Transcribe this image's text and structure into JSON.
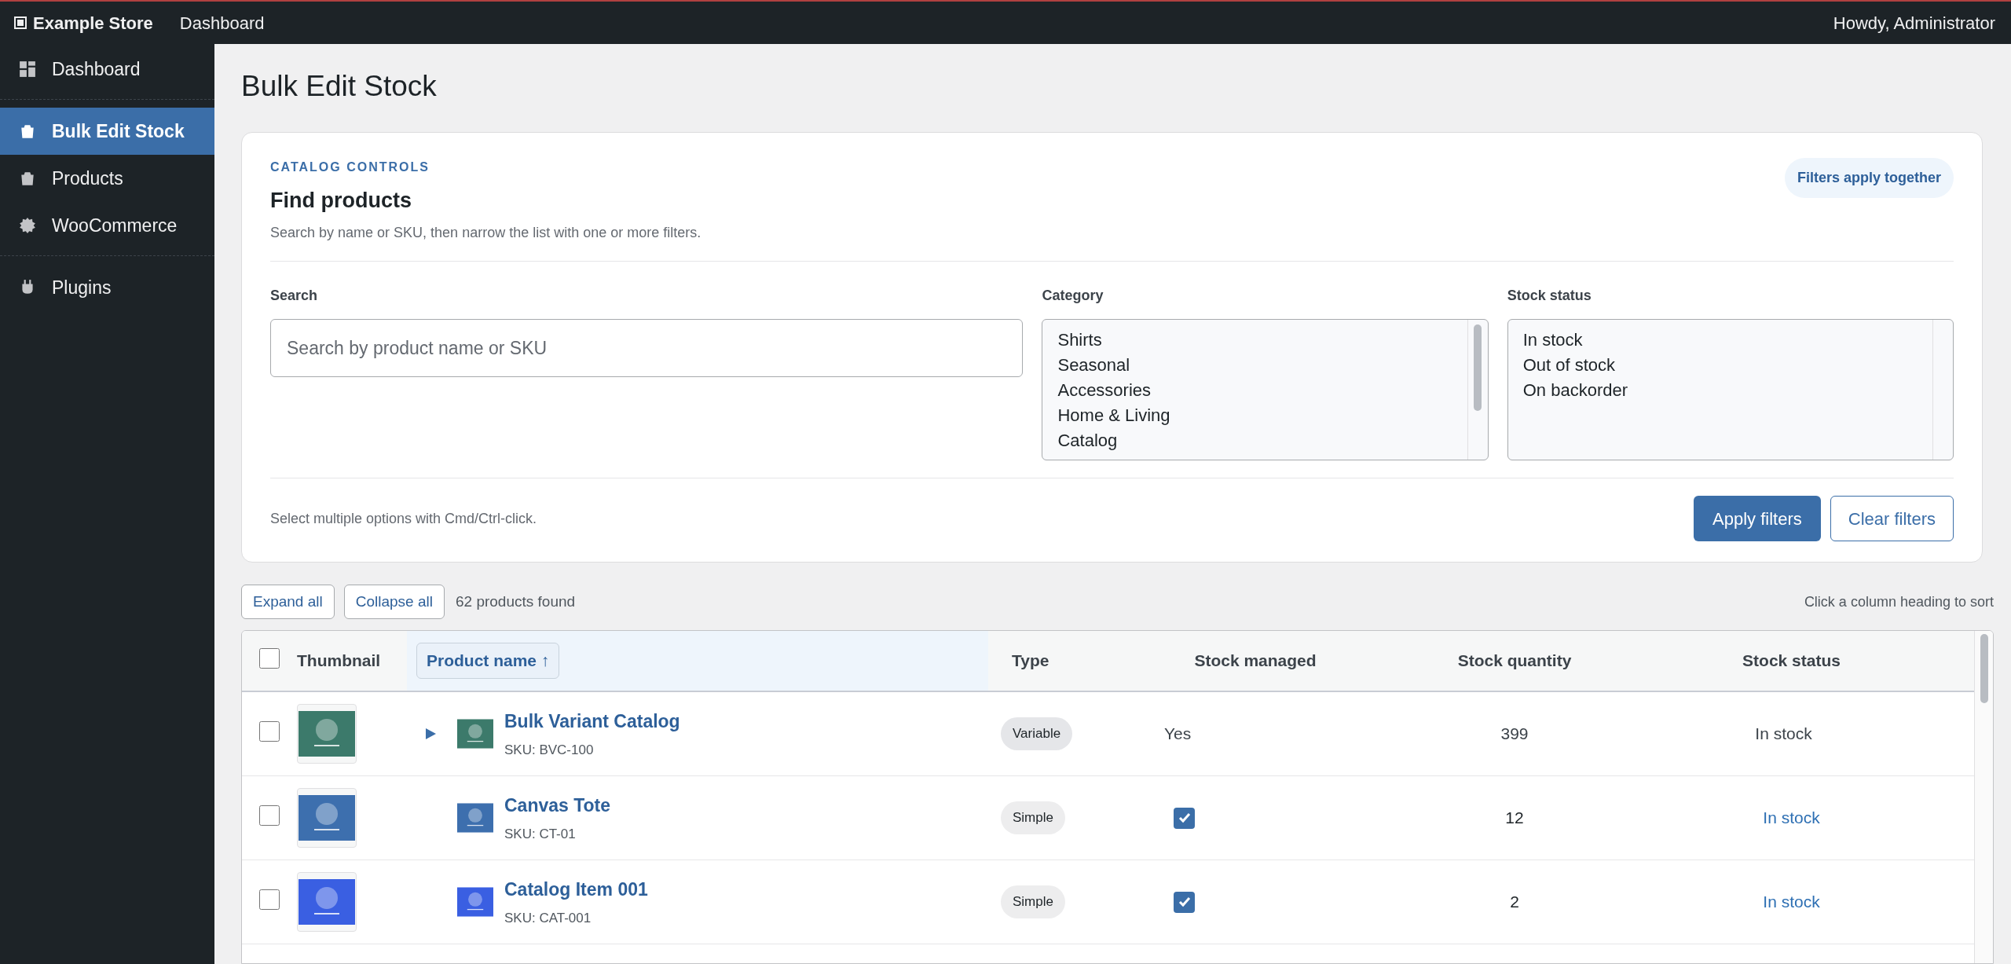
{
  "top_bar": {
    "site": "Example Store",
    "link": "Dashboard",
    "greeting": "Howdy, Administrator"
  },
  "sidebar": {
    "groups": [
      [
        {
          "label": "Dashboard",
          "kind": "dashboard",
          "selected": false
        }
      ],
      [
        {
          "label": "Bulk Edit Stock",
          "kind": "bag",
          "selected": true
        },
        {
          "label": "Products",
          "kind": "bag",
          "selected": false
        },
        {
          "label": "WooCommerce",
          "kind": "gear",
          "selected": false
        }
      ],
      [
        {
          "label": "Plugins",
          "kind": "plug",
          "selected": false
        }
      ]
    ]
  },
  "page_title": "Bulk Edit Stock",
  "controls": {
    "eyebrow": "CATALOG CONTROLS",
    "title": "Find products",
    "subtitle": "Search by name or SKU, then narrow the list with one or more filters.",
    "badge": "Filters apply together",
    "search": {
      "label": "Search",
      "placeholder": "Search by product name or SKU"
    },
    "category": {
      "label": "Category",
      "options": [
        "Shirts",
        "Seasonal",
        "Accessories",
        "Home & Living",
        "Catalog"
      ]
    },
    "stock_status": {
      "label": "Stock status",
      "options": [
        "In stock",
        "Out of stock",
        "On backorder"
      ]
    },
    "hint": "Select multiple options with Cmd/Ctrl-click.",
    "apply_button": "Apply filters",
    "clear_button": "Clear filters"
  },
  "toolbar": {
    "expand": "Expand all",
    "collapse": "Collapse all",
    "count": "62 products found",
    "sort_hint": "Click a column heading to sort"
  },
  "table": {
    "columns": [
      {
        "label": "Thumbnail",
        "sorted": false
      },
      {
        "label": "Product name ↑",
        "sorted": true
      },
      {
        "label": "Type",
        "sorted": false
      },
      {
        "label": "Stock managed",
        "sorted": false
      },
      {
        "label": "Stock quantity",
        "sorted": false
      },
      {
        "label": "Stock status",
        "sorted": false
      }
    ],
    "all_checked": false,
    "rows": [
      {
        "kind": "variable",
        "checked": false,
        "expanded": false,
        "name": "Bulk Variant Catalog",
        "sku": "SKU: BVC-100",
        "color": "#3c7a6b",
        "type": "Variable",
        "managed_text": "Yes",
        "quantity": "399",
        "status": "In stock"
      },
      {
        "kind": "simple",
        "checked": false,
        "name": "Canvas Tote",
        "sku": "SKU: CT-01",
        "color": "#3d6fae",
        "type": "Simple",
        "managed": true,
        "quantity": "12",
        "status": "In stock"
      },
      {
        "kind": "simple",
        "checked": false,
        "name": "Catalog Item 001",
        "sku": "SKU: CAT-001",
        "color": "#3a5fe2",
        "type": "Simple",
        "managed": true,
        "quantity": "2",
        "status": "In stock"
      }
    ]
  }
}
